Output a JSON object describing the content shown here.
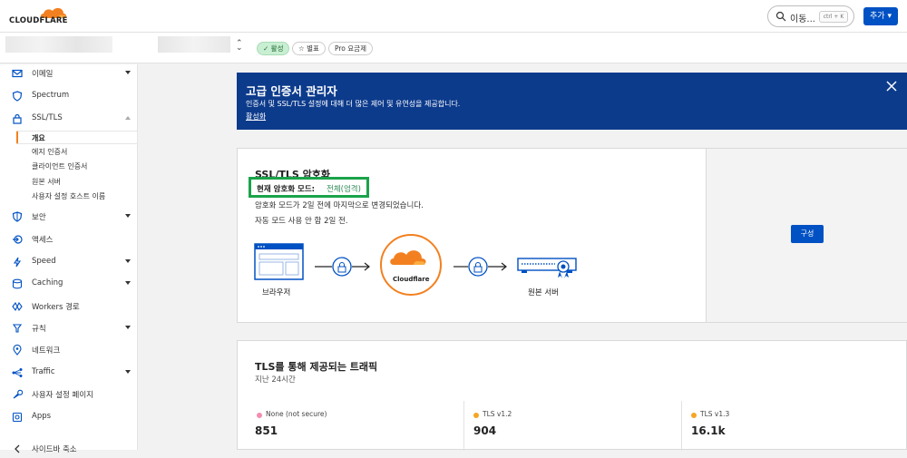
{
  "brand": {
    "name": "CLOUDFLARE",
    "color": "#f38020"
  },
  "topbar": {
    "search_label": "이동...",
    "search_shortcut": "ctrl + K",
    "add_button": "추가"
  },
  "zone": {
    "badges": {
      "active": "✓ 활성",
      "star": "☆ 별표",
      "plan": "Pro 요금제"
    }
  },
  "sidebar": {
    "items": [
      {
        "label": "이메일",
        "icon": "email-icon"
      },
      {
        "label": "Spectrum",
        "icon": "shield-icon"
      },
      {
        "label": "SSL/TLS",
        "icon": "lock-icon"
      },
      {
        "label": "보안",
        "icon": "shield-icon"
      },
      {
        "label": "액세스",
        "icon": "access-icon"
      },
      {
        "label": "Speed",
        "icon": "lightning-icon"
      },
      {
        "label": "Caching",
        "icon": "database-icon"
      },
      {
        "label": "Workers 경로",
        "icon": "workers-icon"
      },
      {
        "label": "규칙",
        "icon": "rules-icon"
      },
      {
        "label": "네트워크",
        "icon": "location-icon"
      },
      {
        "label": "Traffic",
        "icon": "traffic-icon"
      },
      {
        "label": "사용자 설정 페이지",
        "icon": "wrench-icon"
      },
      {
        "label": "Apps",
        "icon": "apps-icon"
      },
      {
        "label": "사이드바 축소",
        "icon": "collapse-icon"
      }
    ],
    "ssl_sub": [
      "개요",
      "에지 인증서",
      "클라이언트 인증서",
      "원본 서버",
      "사용자 설정 호스트 이름"
    ]
  },
  "banner": {
    "title": "고급 인증서 관리자",
    "description": "인증서 및 SSL/TLS 설정에 대해 더 많은 제어 및 유연성을 제공합니다.",
    "link": "활성화",
    "bg_color": "#0d3b8c"
  },
  "encryption": {
    "title": "SSL/TLS 암호화",
    "mode_label": "현재 암호화 모드:",
    "mode_value": "전체(엄격)",
    "changed": "암호화 모드가 2일 전에 마지막으로 변경되었습니다.",
    "auto": "자동 모드 사용 안 함 2일 전.",
    "browser_label": "브라우저",
    "cloud_label": "Cloudflare",
    "origin_label": "원본 서버",
    "configure_button": "구성"
  },
  "traffic": {
    "title": "TLS를 통해 제공되는 트래픽",
    "subtitle": "지난 24시간",
    "stats": [
      {
        "label": "None (not secure)",
        "value": "851",
        "color": "#f28cb1"
      },
      {
        "label": "TLS v1.2",
        "value": "904",
        "color": "#f5a623"
      },
      {
        "label": "TLS v1.3",
        "value": "16.1k",
        "color": "#f5a623"
      }
    ]
  }
}
